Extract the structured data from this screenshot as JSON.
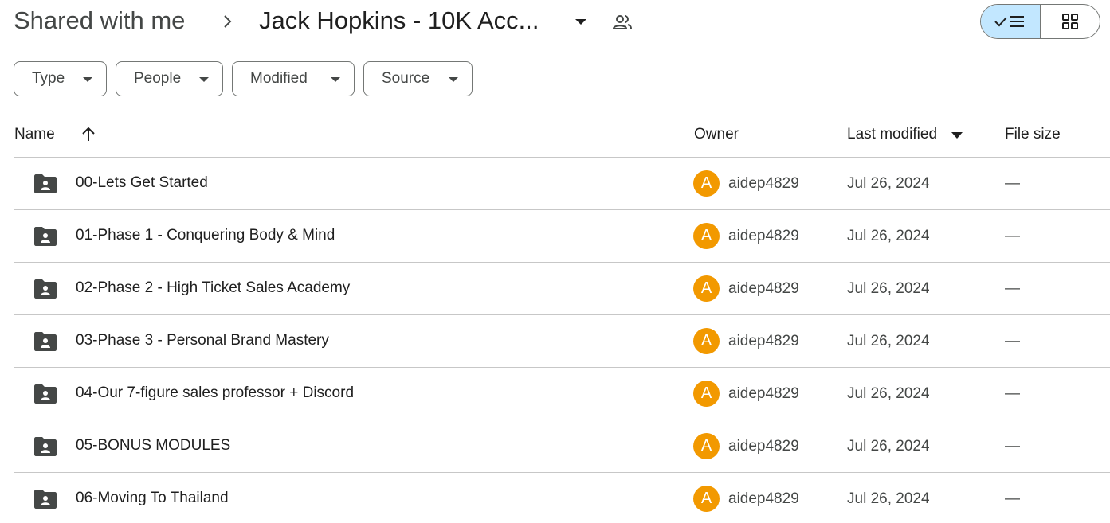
{
  "breadcrumb": {
    "root": "Shared with me",
    "current": "Jack Hopkins - 10K Acc..."
  },
  "icons": {
    "separator": "chevron-right-icon",
    "dropdown": "caret-down-icon",
    "shared": "people-icon",
    "list_view": "check-list-icon",
    "grid_view": "grid-icon",
    "folder": "shared-folder-icon",
    "sort": "arrow-up-icon"
  },
  "colors": {
    "accent": "#c2e7ff",
    "avatar": "#f29900",
    "divider": "#c7c7c7"
  },
  "filters": [
    {
      "label": "Type"
    },
    {
      "label": "People"
    },
    {
      "label": "Modified"
    },
    {
      "label": "Source"
    }
  ],
  "columns": {
    "name": "Name",
    "owner": "Owner",
    "last_modified": "Last modified",
    "file_size": "File size"
  },
  "rows": [
    {
      "name": "00-Lets Get Started",
      "avatar": "A",
      "owner": "aidep4829",
      "modified": "Jul 26, 2024",
      "size": "—"
    },
    {
      "name": "01-Phase 1 - Conquering Body & Mind",
      "avatar": "A",
      "owner": "aidep4829",
      "modified": "Jul 26, 2024",
      "size": "—"
    },
    {
      "name": "02-Phase 2 - High Ticket Sales Academy",
      "avatar": "A",
      "owner": "aidep4829",
      "modified": "Jul 26, 2024",
      "size": "—"
    },
    {
      "name": "03-Phase 3 - Personal Brand Mastery",
      "avatar": "A",
      "owner": "aidep4829",
      "modified": "Jul 26, 2024",
      "size": "—"
    },
    {
      "name": "04-Our 7-figure sales professor + Discord",
      "avatar": "A",
      "owner": "aidep4829",
      "modified": "Jul 26, 2024",
      "size": "—"
    },
    {
      "name": "05-BONUS MODULES",
      "avatar": "A",
      "owner": "aidep4829",
      "modified": "Jul 26, 2024",
      "size": "—"
    },
    {
      "name": "06-Moving To Thailand",
      "avatar": "A",
      "owner": "aidep4829",
      "modified": "Jul 26, 2024",
      "size": "—"
    }
  ]
}
